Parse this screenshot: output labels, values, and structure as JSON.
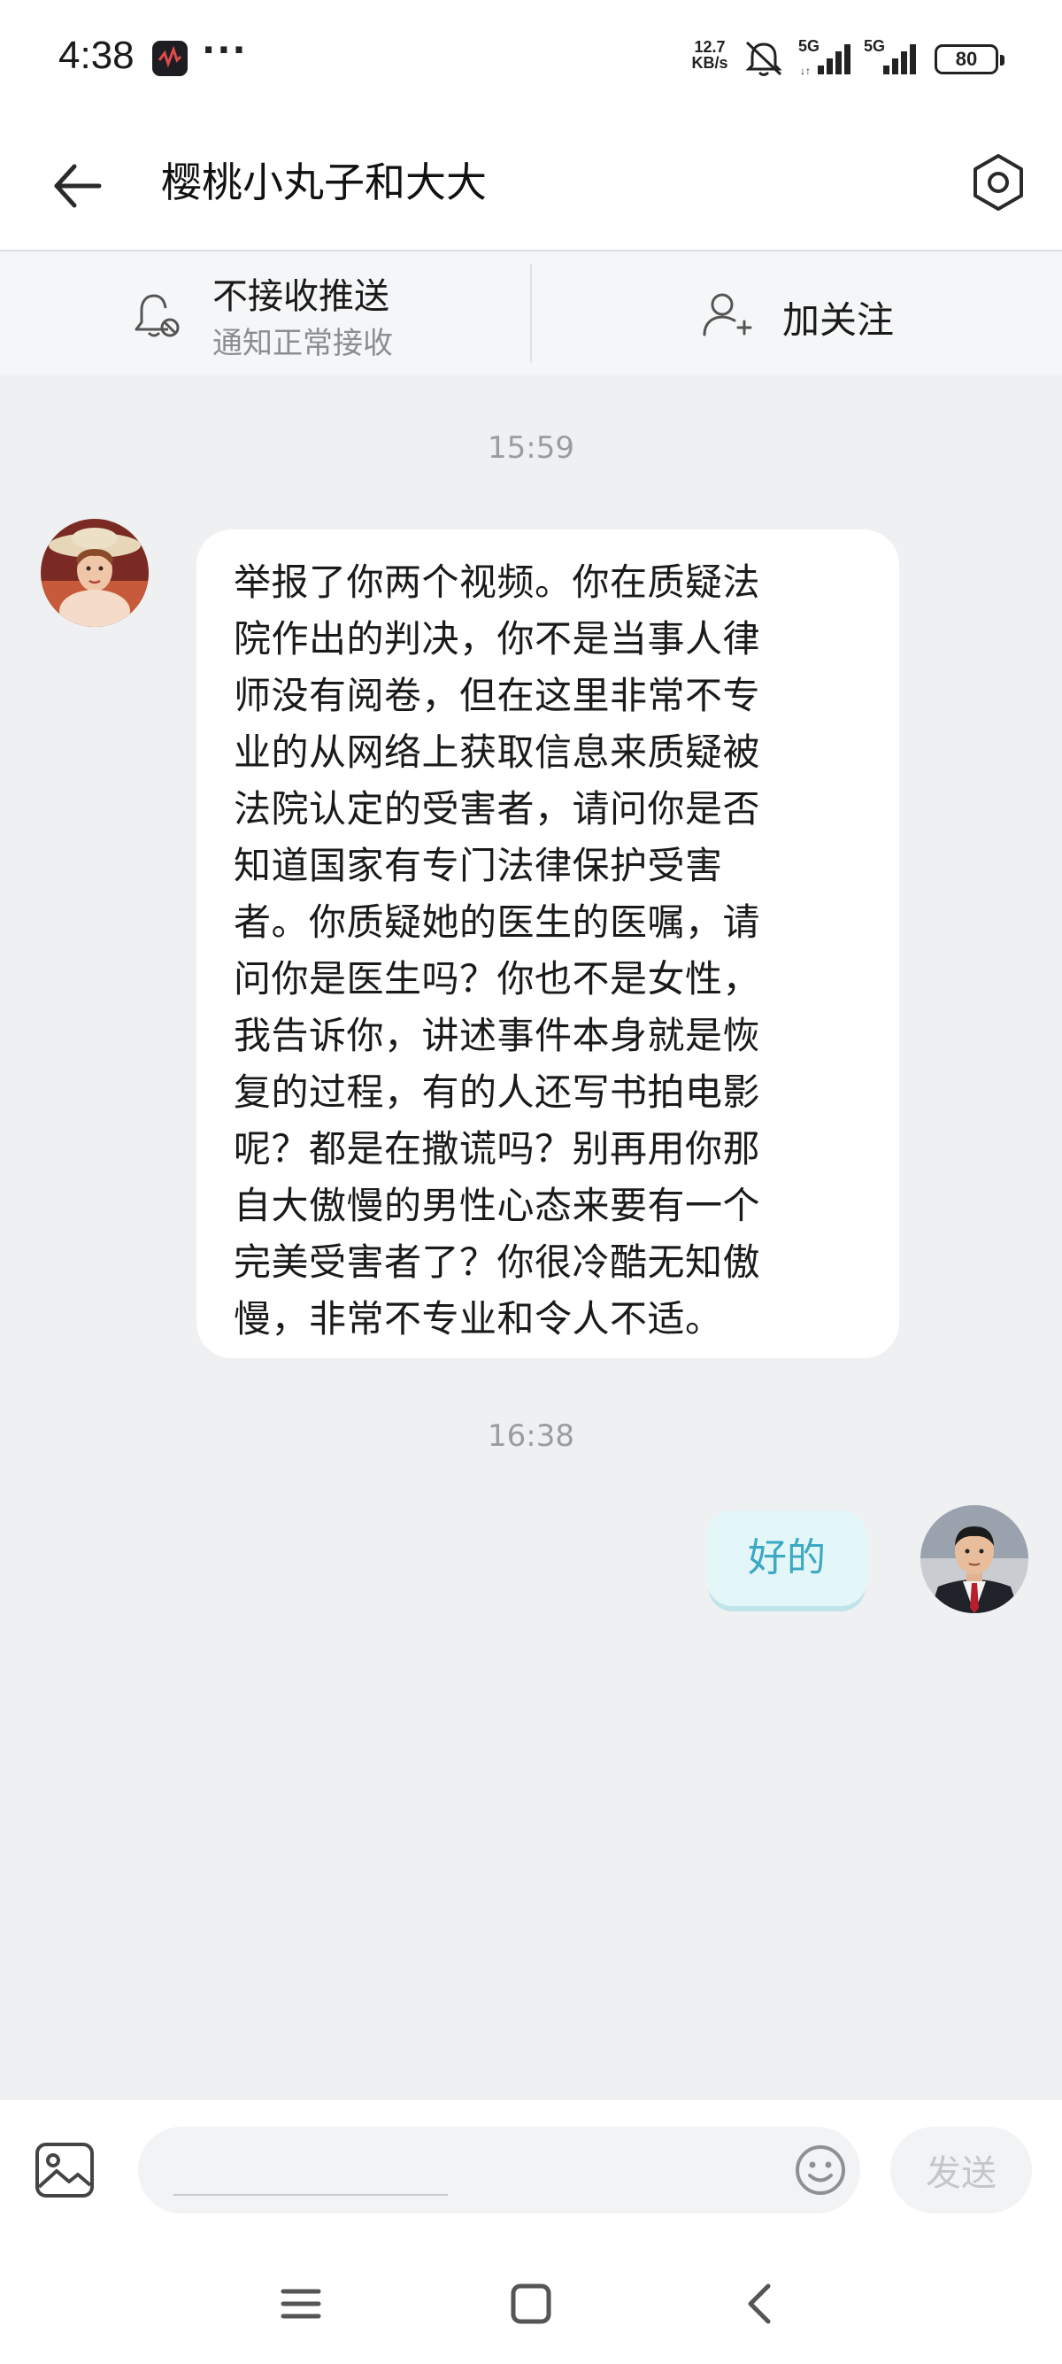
{
  "status_bar": {
    "time": "4:38",
    "more": "···",
    "net_speed_value": "12.7",
    "net_speed_unit": "KB/s",
    "signal_1_label": "5G",
    "signal_2_label": "5G",
    "battery": "80",
    "icons": [
      "app-notification-icon",
      "mute-icon",
      "signal-icon",
      "signal-icon",
      "battery-icon"
    ]
  },
  "header": {
    "title": "樱桃小丸子和大大",
    "back_icon": "arrow-left-icon",
    "settings_icon": "hexagon-settings-icon"
  },
  "subscription": {
    "push_title": "不接收推送",
    "push_subtitle": "通知正常接收",
    "follow_label": "加关注"
  },
  "messages": [
    {
      "time": "15:59",
      "direction": "incoming",
      "lines": [
        "举报了你两个视频。你在质疑法",
        "院作出的判决，你不是当事人律",
        "师没有阅卷，但在这里非常不专",
        "业的从网络上获取信息来质疑被",
        "法院认定的受害者，请问你是否",
        "知道国家有专门法律保护受害",
        "者。你质疑她的医生的医嘱，请",
        "问你是医生吗？你也不是女性，",
        "我告诉你，讲述事件本身就是恢",
        "复的过程，有的人还写书拍电影",
        "呢？都是在撒谎吗？别再用你那",
        "自大傲慢的男性心态来要有一个",
        "完美受害者了？你很冷酷无知傲",
        "慢，非常不专业和令人不适。"
      ]
    },
    {
      "time": "16:38",
      "direction": "outgoing",
      "text": "好的"
    }
  ],
  "input": {
    "placeholder": "",
    "send_label": "发送"
  },
  "colors": {
    "background": "#eff0f2",
    "outgoing_bubble": "#e3f6f8",
    "outgoing_text": "#3ba8c4"
  }
}
